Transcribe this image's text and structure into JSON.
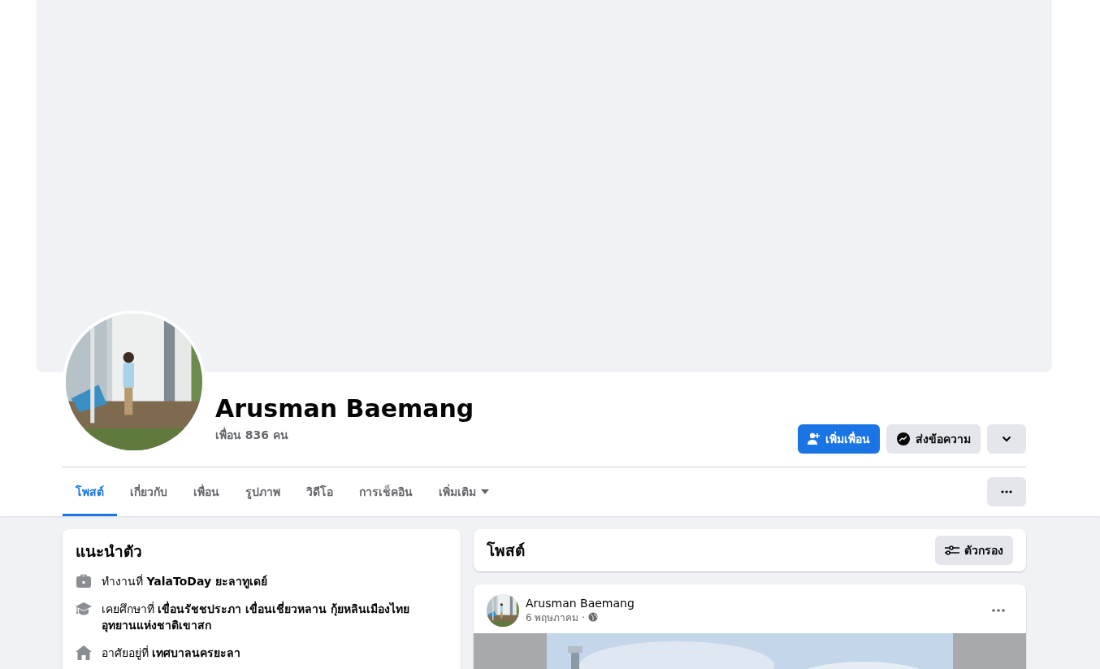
{
  "profile": {
    "name": "Arusman Baemang",
    "friends": "เพื่อน 836 คน"
  },
  "actions": [
    {
      "kind": "add-friend",
      "label": "เพิ่มเพื่อน"
    },
    {
      "kind": "message",
      "label": "ส่งข้อความ"
    },
    {
      "kind": "expand"
    }
  ],
  "tabs": [
    {
      "label": "โพสต์",
      "selected": true
    },
    {
      "label": "เกี่ยวกับ",
      "selected": false
    },
    {
      "label": "เพื่อน",
      "selected": false
    },
    {
      "label": "รูปภาพ",
      "selected": false
    },
    {
      "label": "วิดีโอ",
      "selected": false
    },
    {
      "label": "การเช็คอิน",
      "selected": false
    },
    {
      "label": "เพิ่มเติม",
      "selected": false,
      "dropdown": true
    }
  ],
  "intro": {
    "title": "แนะนำตัว",
    "items": [
      {
        "kind": "work",
        "text": "ทำงานที่ **YalaToDay ยะลาทูเดย์**"
      },
      {
        "kind": "education",
        "text": "เคยศึกษาที่ **เขื่อนรัชชประภา เขื่อนเชี่ยวหลาน กุ้ยหลินเมืองไทย อุทยานแห่งชาติเขาสก**"
      },
      {
        "kind": "home",
        "text": "อาศัยอยู่ที่ **เทศบาลนครยะลา**"
      }
    ]
  },
  "posts_header": {
    "title": "โพสต์",
    "filter": "ตัวกรอง"
  },
  "post": {
    "author": "Arusman Baemang",
    "date": "6 พฤษภาคม ·",
    "public": true
  }
}
